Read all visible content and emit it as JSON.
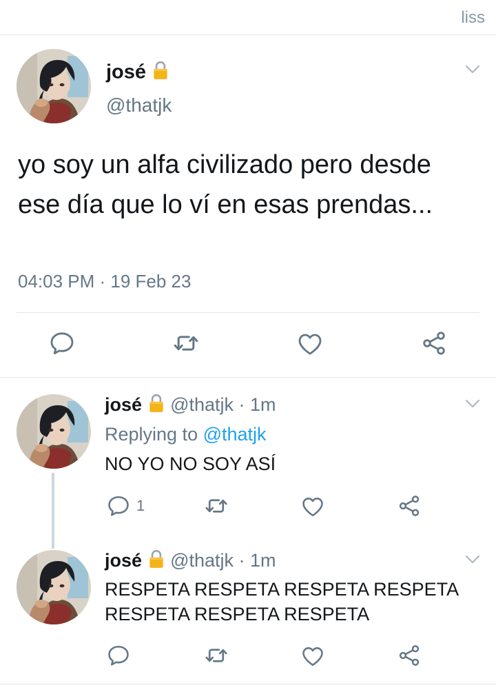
{
  "header": {
    "label": "liss"
  },
  "tweet": {
    "author_name": "josé",
    "author_handle": "@thatjk",
    "text": "yo soy un alfa civilizado pero desde ese día que lo ví en esas prendas...",
    "timestamp": "04:03 PM · 19 Feb 23"
  },
  "replies": [
    {
      "author_name": "josé",
      "author_handle": "@thatjk",
      "time": "· 1m",
      "replying_prefix": "Replying to",
      "replying_handle": "@thatjk",
      "text": "NO YO NO SOY ASÍ",
      "reply_count": "1"
    },
    {
      "author_name": "josé",
      "author_handle": "@thatjk",
      "time": "· 1m",
      "text": "RESPETA RESPETA RESPETA RESPETA RESPETA RESPETA RESPETA"
    }
  ],
  "colors": {
    "text": "#14171a",
    "secondary": "#657786",
    "link": "#1da1f2",
    "divider": "#e1e8ed",
    "icon": "#657786",
    "lock": "#f5b31a"
  },
  "icons": [
    "lock-icon",
    "chevron-down-icon",
    "reply-icon",
    "retweet-icon",
    "like-icon",
    "share-icon"
  ]
}
